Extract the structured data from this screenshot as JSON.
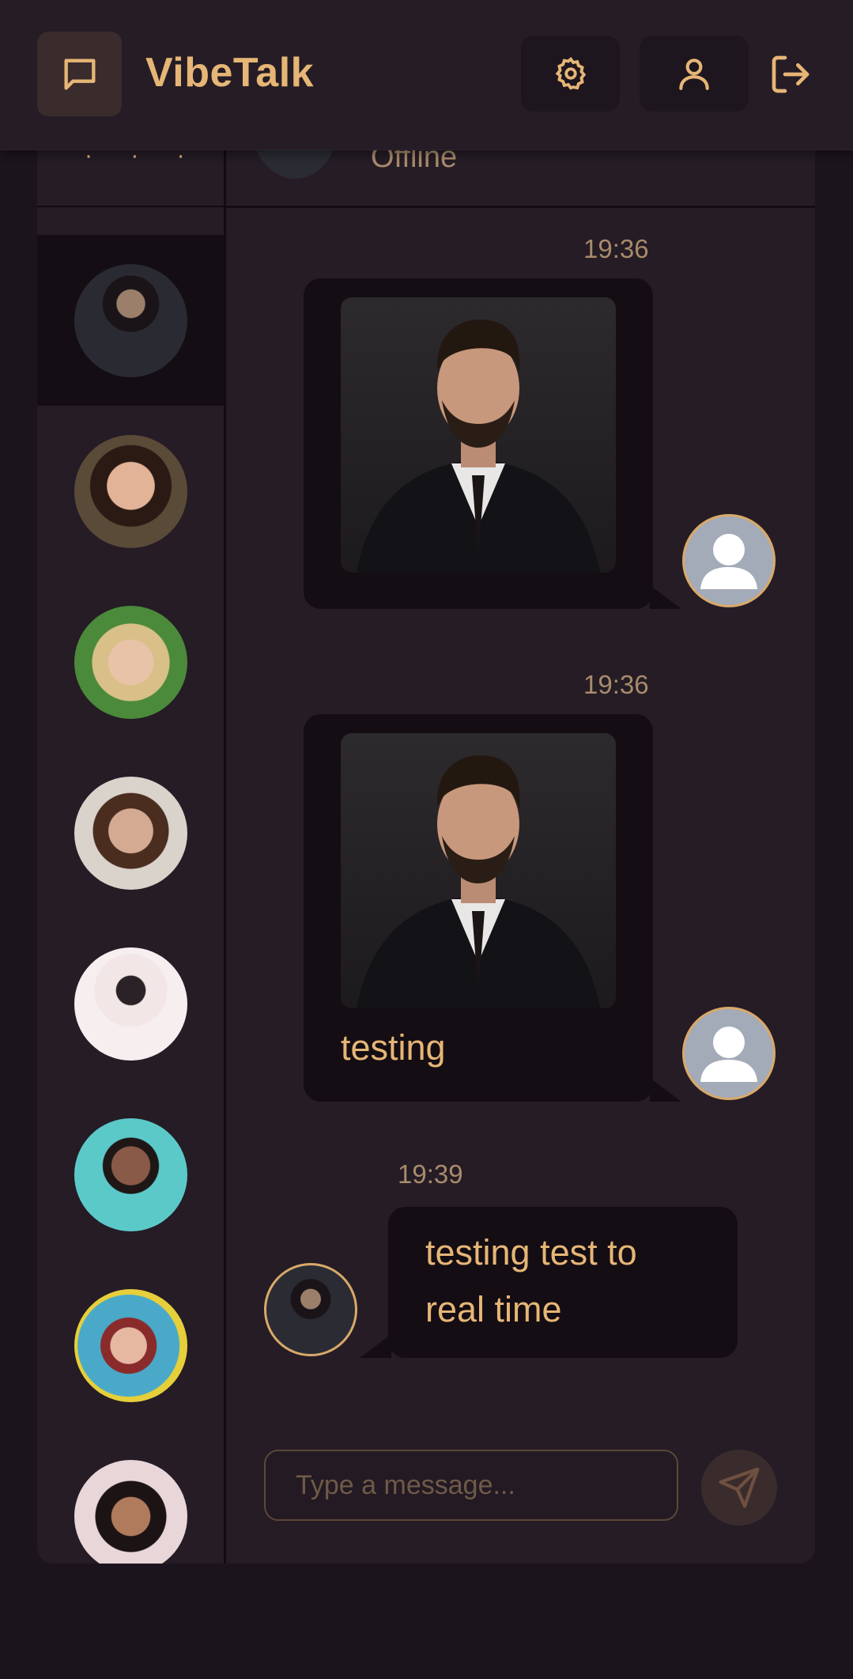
{
  "app": {
    "title": "VibeTalk"
  },
  "header": {
    "icons": {
      "logo": "chat-bubble-icon",
      "settings": "gear-icon",
      "profile": "user-icon",
      "logout": "logout-icon"
    }
  },
  "sidebar": {
    "top_fragment": "· · ·",
    "contacts": [
      {
        "avatar": "man-in-suit",
        "active": true
      },
      {
        "avatar": "woman-smiling-dark-hair",
        "active": false
      },
      {
        "avatar": "woman-blonde-smiling",
        "active": false
      },
      {
        "avatar": "woman-brown-hair",
        "active": false
      },
      {
        "avatar": "person-white-background",
        "active": false
      },
      {
        "avatar": "woman-glasses-teal",
        "active": false
      },
      {
        "avatar": "woman-red-hair-blue",
        "active": false
      },
      {
        "avatar": "woman-sunglasses-on-head",
        "active": false
      }
    ]
  },
  "chat": {
    "contact_status": "Offline",
    "messages": [
      {
        "time": "19:36",
        "direction": "sent",
        "type": "image",
        "text": ""
      },
      {
        "time": "19:36",
        "direction": "sent",
        "type": "image",
        "text": "testing"
      },
      {
        "time": "19:39",
        "direction": "received",
        "type": "text",
        "lines": [
          "testing test to",
          "real time"
        ]
      }
    ]
  },
  "composer": {
    "placeholder": "Type a message...",
    "send_icon": "send-icon"
  },
  "colors": {
    "accent": "#e6b676",
    "background": "#1c141c",
    "panel": "#251c25",
    "bubble": "#140d14"
  }
}
